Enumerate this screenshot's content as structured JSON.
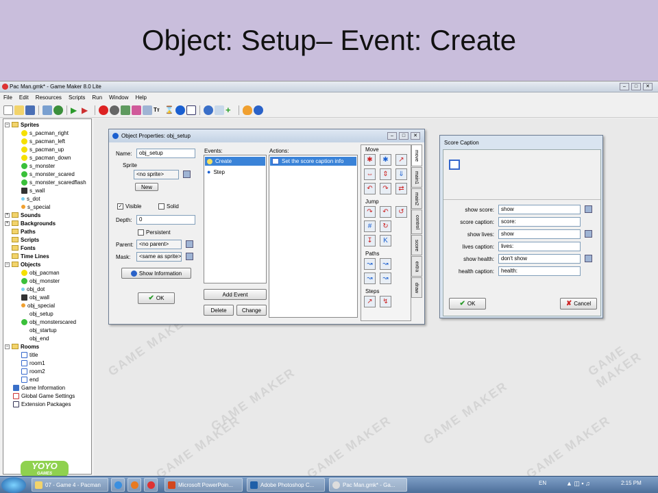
{
  "slide": {
    "title": "Object: Setup– Event: Create"
  },
  "window": {
    "title": "Pac Man.gmk* - Game Maker 8.0 Lite"
  },
  "menu": [
    "File",
    "Edit",
    "Resources",
    "Scripts",
    "Run",
    "Window",
    "Help"
  ],
  "tree": {
    "sprites": {
      "label": "Sprites",
      "items": [
        "s_pacman_right",
        "s_pacman_left",
        "s_pacman_up",
        "s_pacman_down",
        "s_monster",
        "s_monster_scared",
        "s_monster_scaredflash",
        "s_wall",
        "s_dot",
        "s_special"
      ]
    },
    "sounds": "Sounds",
    "backgrounds": "Backgrounds",
    "paths": "Paths",
    "scripts": "Scripts",
    "fonts": "Fonts",
    "timelines": "Time Lines",
    "objects": {
      "label": "Objects",
      "items": [
        "obj_pacman",
        "obj_monster",
        "obj_dot",
        "obj_wall",
        "obj_special",
        "obj_setup",
        "obj_monsterscared",
        "obj_startup",
        "obj_end"
      ]
    },
    "rooms": {
      "label": "Rooms",
      "items": [
        "title",
        "room1",
        "room2",
        "end"
      ]
    },
    "extras": [
      "Game Information",
      "Global Game Settings",
      "Extension Packages"
    ]
  },
  "logo": {
    "text": "YOYO",
    "sub": "GAMES"
  },
  "watermark": "GAME MAKER",
  "object_props": {
    "title": "Object Properties: obj_setup",
    "name_label": "Name:",
    "name_value": "obj_setup",
    "sprite_label": "Sprite",
    "sprite_value": "<no sprite>",
    "new_label": "New",
    "visible_label": "Visible",
    "solid_label": "Solid",
    "depth_label": "Depth:",
    "depth_value": "0",
    "persistent_label": "Persistent",
    "parent_label": "Parent:",
    "parent_value": "<no parent>",
    "mask_label": "Mask:",
    "mask_value": "<same as sprite>",
    "show_info_label": "Show Information",
    "ok_label": "OK",
    "events_label": "Events:",
    "events": [
      "Create",
      "Step"
    ],
    "add_event_label": "Add Event",
    "delete_label": "Delete",
    "change_label": "Change",
    "actions_label": "Actions:",
    "actions": [
      "Set the score caption info"
    ],
    "sections": {
      "move": "Move",
      "jump": "Jump",
      "paths": "Paths",
      "steps": "Steps"
    },
    "tabs": [
      "move",
      "main1",
      "main2",
      "control",
      "score",
      "extra",
      "draw"
    ]
  },
  "score_caption": {
    "title": "Score Caption",
    "rows": [
      {
        "label": "show score:",
        "value": "show"
      },
      {
        "label": "score caption:",
        "value": "score:"
      },
      {
        "label": "show lives:",
        "value": "show"
      },
      {
        "label": "lives caption:",
        "value": "lives:"
      },
      {
        "label": "show health:",
        "value": "don't show"
      },
      {
        "label": "health caption:",
        "value": "health:"
      }
    ],
    "ok_label": "OK",
    "cancel_label": "Cancel"
  },
  "taskbar": {
    "tasks": [
      "07 - Game 4 - Pacman",
      "Microsoft PowerPoin...",
      "Adobe Photoshop C...",
      "Pac Man.gmk* - Ga..."
    ],
    "lang": "EN",
    "time": "2:15 PM"
  }
}
